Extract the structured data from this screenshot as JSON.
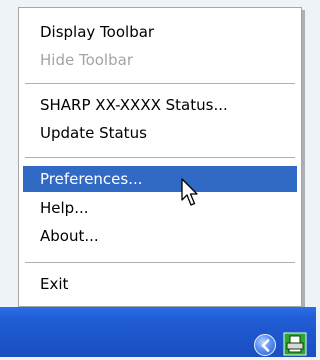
{
  "context_menu": {
    "items": [
      {
        "label": "Display Toolbar",
        "state": "enabled"
      },
      {
        "label": "Hide Toolbar",
        "state": "disabled"
      },
      {
        "label": "SHARP XX-XXXX Status...",
        "state": "enabled"
      },
      {
        "label": "Update Status",
        "state": "enabled"
      },
      {
        "label": "Preferences...",
        "state": "highlighted"
      },
      {
        "label": "Help...",
        "state": "enabled"
      },
      {
        "label": "About...",
        "state": "enabled"
      },
      {
        "label": "Exit",
        "state": "enabled"
      }
    ]
  },
  "tray": {
    "icons": [
      "show-hidden-icons-chevron-icon",
      "printer-status-icon"
    ]
  },
  "colors": {
    "menu_highlight": "#316ac5",
    "taskbar": "#225fd6",
    "disabled_text": "#a3a3a3"
  }
}
